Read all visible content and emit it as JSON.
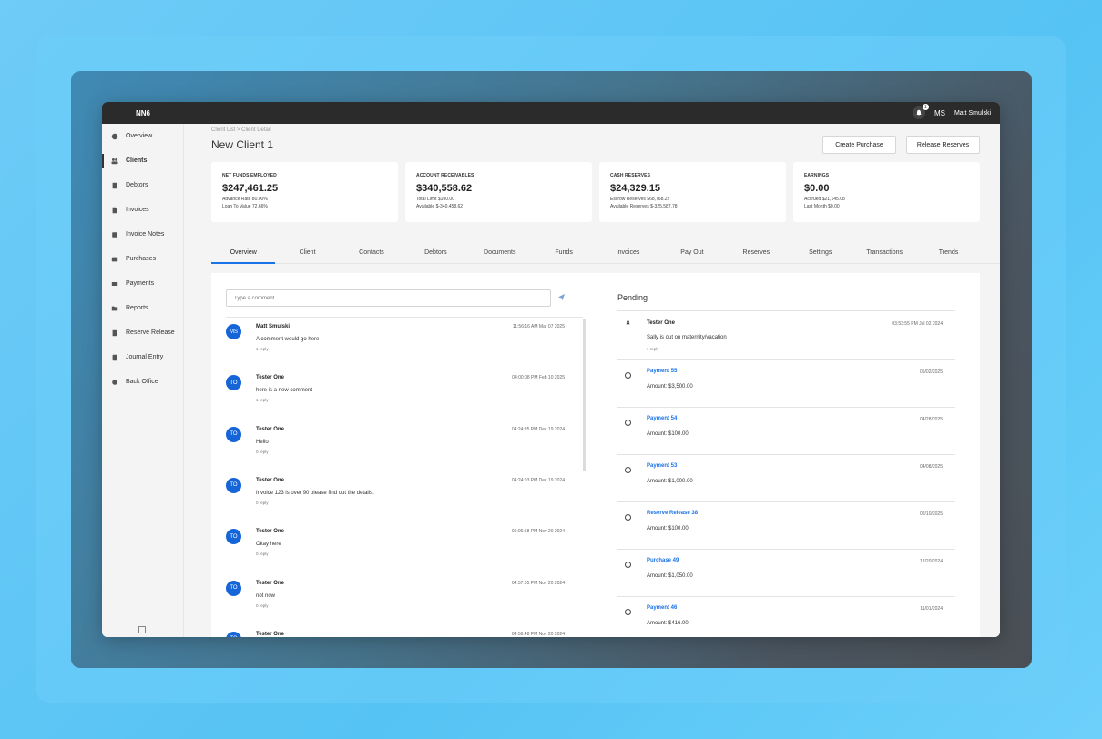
{
  "app": {
    "name": "NN6",
    "notification_count": "1",
    "user_initials": "MS",
    "user_name": "Matt Smulski"
  },
  "sidebar": {
    "items": [
      {
        "label": "Overview",
        "icon": "dashboard-icon"
      },
      {
        "label": "Clients",
        "icon": "people-icon",
        "active": true
      },
      {
        "label": "Debtors",
        "icon": "building-icon"
      },
      {
        "label": "Invoices",
        "icon": "document-icon"
      },
      {
        "label": "Invoice Notes",
        "icon": "note-icon"
      },
      {
        "label": "Purchases",
        "icon": "cart-icon"
      },
      {
        "label": "Payments",
        "icon": "card-icon"
      },
      {
        "label": "Reports",
        "icon": "folder-icon"
      },
      {
        "label": "Reserve Release",
        "icon": "release-icon"
      },
      {
        "label": "Journal Entry",
        "icon": "book-icon"
      },
      {
        "label": "Back Office",
        "icon": "gear-icon"
      }
    ]
  },
  "header": {
    "breadcrumb": "Client List  >  Client Detail",
    "title": "New Client 1",
    "create_purchase": "Create Purchase",
    "release_reserves": "Release Reserves"
  },
  "cards": [
    {
      "label": "NET FUNDS EMPLOYED",
      "value": "$247,461.25",
      "line1": "Advance Rate  80.00%",
      "line2": "Loan To Value  72.66%"
    },
    {
      "label": "ACCOUNT RECEIVABLES",
      "value": "$340,558.62",
      "line1": "Total Limit  $100.00",
      "line2": "Available  $-340,458.62"
    },
    {
      "label": "CASH RESERVES",
      "value": "$24,329.15",
      "line1": "Escrow Reserves  $68,768.22",
      "line2": "Available Reserves  $-325,587.78"
    },
    {
      "label": "EARNINGS",
      "value": "$0.00",
      "line1": "Accrued  $21,145.08",
      "line2": "Last Month  $0.00"
    }
  ],
  "tabs": [
    "Overview",
    "Client",
    "Contacts",
    "Debtors",
    "Documents",
    "Funds",
    "Invoices",
    "Pay Out",
    "Reserves",
    "Settings",
    "Transactions",
    "Trends"
  ],
  "comments": {
    "placeholder": "Type a comment",
    "items": [
      {
        "initials": "MS",
        "name": "Matt Smulski",
        "time": "11:56:16 AM Mar 07 2025",
        "text": "A comment would go here",
        "replies": "1 reply"
      },
      {
        "initials": "TO",
        "name": "Tester One",
        "time": "04:00:08 PM Feb 10 2025",
        "text": "here is a new comment",
        "replies": "1 reply"
      },
      {
        "initials": "TO",
        "name": "Tester One",
        "time": "04:24:35 PM Dec 19 2024",
        "text": "Hello",
        "replies": "0 reply"
      },
      {
        "initials": "TO",
        "name": "Tester One",
        "time": "04:24:03 PM Dec 19 2024",
        "text": "Invoice 123 is over 90 please find out the details.",
        "replies": "0 reply"
      },
      {
        "initials": "TO",
        "name": "Tester One",
        "time": "05:06:58 PM Nov 20 2024",
        "text": "Okay here",
        "replies": "0 reply"
      },
      {
        "initials": "TO",
        "name": "Tester One",
        "time": "04:57:05 PM Nov 20 2024",
        "text": "not now",
        "replies": "0 reply"
      },
      {
        "initials": "TO",
        "name": "Tester One",
        "time": "04:56:48 PM Nov 20 2024",
        "text": "",
        "replies": ""
      }
    ]
  },
  "pending": {
    "title": "Pending",
    "note": {
      "name": "Tester One",
      "time": "03:53:55 PM Jul 02 2024",
      "text": "Sally is out on maternity/vacation",
      "replies": "1 reply"
    },
    "items": [
      {
        "title": "Payment 55",
        "date": "05/02/2025",
        "amount": "Amount: $3,500.00"
      },
      {
        "title": "Payment 54",
        "date": "04/28/2025",
        "amount": "Amount: $100.00"
      },
      {
        "title": "Payment 53",
        "date": "04/08/2025",
        "amount": "Amount: $1,000.00"
      },
      {
        "title": "Reserve Release 38",
        "date": "02/10/2025",
        "amount": "Amount: $100.00"
      },
      {
        "title": "Purchase 49",
        "date": "12/20/2024",
        "amount": "Amount: $1,050.00"
      },
      {
        "title": "Payment 46",
        "date": "11/01/2024",
        "amount": "Amount: $416.00"
      }
    ]
  }
}
